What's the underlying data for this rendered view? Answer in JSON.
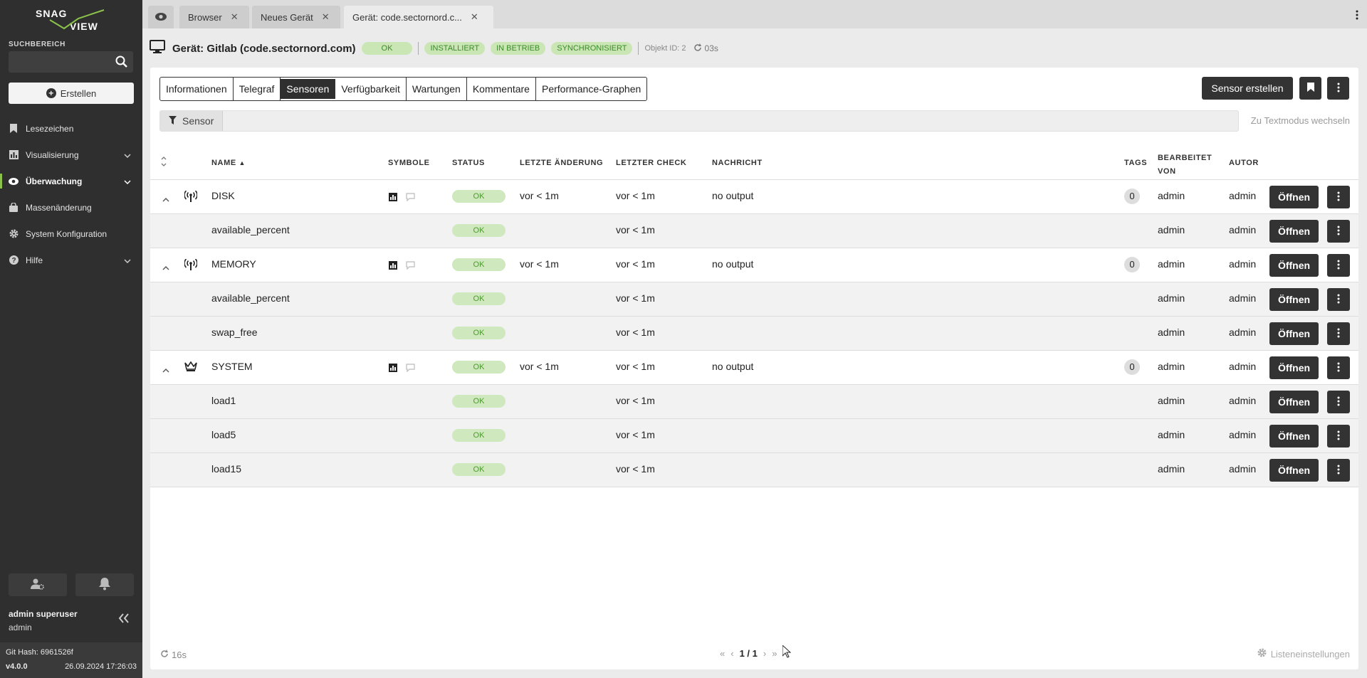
{
  "brand": {
    "logo_text_top": "SNAG",
    "logo_text_bottom": "VIEW",
    "accent": "#8bc34a"
  },
  "sidebar": {
    "search_label": "SUCHBEREICH",
    "search_value": "",
    "create_label": "Erstellen",
    "items": [
      {
        "label": "Lesezeichen",
        "icon": "bookmark-icon"
      },
      {
        "label": "Visualisierung",
        "icon": "chart-icon",
        "expandable": true
      },
      {
        "label": "Überwachung",
        "icon": "eye-icon",
        "expandable": true,
        "active": true
      },
      {
        "label": "Massenänderung",
        "icon": "bag-icon"
      },
      {
        "label": "System Konfiguration",
        "icon": "gear-icon"
      },
      {
        "label": "Hilfe",
        "icon": "help-icon",
        "expandable": true
      }
    ],
    "user_name": "admin superuser",
    "user_role": "admin",
    "git_hash": "Git Hash: 6961526f",
    "version": "v4.0.0",
    "datetime": "26.09.2024 17:26:03"
  },
  "tabs": [
    {
      "label": "Browser",
      "closable": true
    },
    {
      "label": "Neues Gerät",
      "closable": true
    },
    {
      "label": "Gerät: code.sectornord.c...",
      "closable": true,
      "active": true
    }
  ],
  "header": {
    "title": "Gerät: Gitlab (code.sectornord.com)",
    "status": "OK",
    "badges": [
      "INSTALLIERT",
      "IN BETRIEB",
      "SYNCHRONISIERT"
    ],
    "object_id": "Objekt ID: 2",
    "refresh": "03s"
  },
  "subtabs": [
    "Informationen",
    "Telegraf",
    "Sensoren",
    "Verfügbarkeit",
    "Wartungen",
    "Kommentare",
    "Performance-Graphen"
  ],
  "active_subtab": "Sensoren",
  "toolbar": {
    "create_sensor": "Sensor erstellen"
  },
  "filter": {
    "chip_label": "Sensor",
    "value": "",
    "textmode_label": "Zu Textmodus wechseln"
  },
  "table": {
    "columns": {
      "name": "NAME",
      "symbols": "SYMBOLE",
      "status": "STATUS",
      "last_change": "LETZTE ÄNDERUNG",
      "last_check": "LETZTER CHECK",
      "message": "NACHRICHT",
      "tags": "TAGS",
      "edited_by_1": "BEARBEITET",
      "edited_by_2": "VON",
      "author": "AUTOR"
    },
    "open_label": "Öffnen",
    "rows": [
      {
        "type": "parent",
        "icon": "antenna-icon",
        "name": "DISK",
        "status": "OK",
        "last_change": "vor < 1m",
        "last_check": "vor < 1m",
        "message": "no output",
        "tags": "0",
        "edited_by": "admin",
        "author": "admin"
      },
      {
        "type": "child",
        "name": "available_percent",
        "status": "OK",
        "last_change": "",
        "last_check": "vor < 1m",
        "message": "",
        "tags": "",
        "edited_by": "admin",
        "author": "admin"
      },
      {
        "type": "parent",
        "icon": "antenna-icon",
        "name": "MEMORY",
        "status": "OK",
        "last_change": "vor < 1m",
        "last_check": "vor < 1m",
        "message": "no output",
        "tags": "0",
        "edited_by": "admin",
        "author": "admin"
      },
      {
        "type": "child",
        "name": "available_percent",
        "status": "OK",
        "last_change": "",
        "last_check": "vor < 1m",
        "message": "",
        "tags": "",
        "edited_by": "admin",
        "author": "admin"
      },
      {
        "type": "child",
        "name": "swap_free",
        "status": "OK",
        "last_change": "",
        "last_check": "vor < 1m",
        "message": "",
        "tags": "",
        "edited_by": "admin",
        "author": "admin"
      },
      {
        "type": "parent",
        "icon": "crown-icon",
        "name": "SYSTEM",
        "status": "OK",
        "last_change": "vor < 1m",
        "last_check": "vor < 1m",
        "message": "no output",
        "tags": "0",
        "edited_by": "admin",
        "author": "admin"
      },
      {
        "type": "child",
        "name": "load1",
        "status": "OK",
        "last_change": "",
        "last_check": "vor < 1m",
        "message": "",
        "tags": "",
        "edited_by": "admin",
        "author": "admin"
      },
      {
        "type": "child",
        "name": "load5",
        "status": "OK",
        "last_change": "",
        "last_check": "vor < 1m",
        "message": "",
        "tags": "",
        "edited_by": "admin",
        "author": "admin"
      },
      {
        "type": "child",
        "name": "load15",
        "status": "OK",
        "last_change": "",
        "last_check": "vor < 1m",
        "message": "",
        "tags": "",
        "edited_by": "admin",
        "author": "admin"
      }
    ]
  },
  "footer": {
    "refresh": "16s",
    "pagination": "1 / 1",
    "list_settings": "Listeneinstellungen"
  }
}
